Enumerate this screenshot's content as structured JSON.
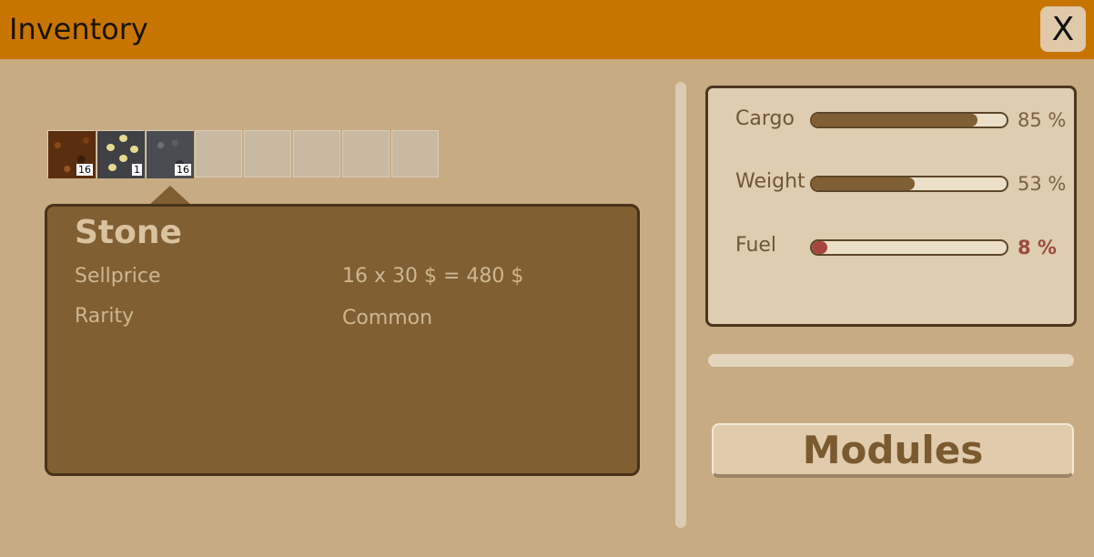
{
  "window": {
    "title": "Inventory",
    "close_label": "X"
  },
  "slots": [
    {
      "item": "dirt",
      "count": "16"
    },
    {
      "item": "ore",
      "count": "1"
    },
    {
      "item": "stone",
      "count": "16"
    },
    {
      "item": null,
      "count": null
    },
    {
      "item": null,
      "count": null
    },
    {
      "item": null,
      "count": null
    },
    {
      "item": null,
      "count": null
    },
    {
      "item": null,
      "count": null
    }
  ],
  "tooltip": {
    "name": "Stone",
    "sellprice_label": "Sellprice",
    "sellprice_value": "16 x 30 $ = 480 $",
    "rarity_label": "Rarity",
    "rarity_value": "Common"
  },
  "stats": {
    "cargo": {
      "label": "Cargo",
      "value_text": "85 %",
      "percent": 85,
      "color": "#7f5f33"
    },
    "weight": {
      "label": "Weight",
      "value_text": "53 %",
      "percent": 53,
      "color": "#7f5f33"
    },
    "fuel": {
      "label": "Fuel",
      "value_text": "8 %",
      "percent": 8,
      "color": "#a9453f"
    }
  },
  "buttons": {
    "modules_label": "Modules"
  }
}
